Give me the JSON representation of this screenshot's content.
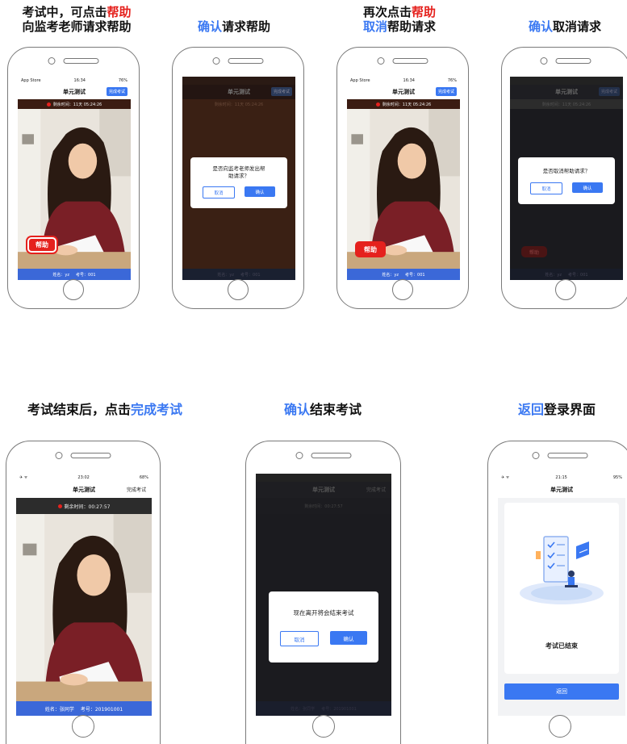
{
  "captions": {
    "c1": {
      "a": "考试中，可点击",
      "b": "帮助",
      "c": "向监考老师请求帮助"
    },
    "c2": {
      "a": "确认",
      "b": "请求帮助"
    },
    "c3": {
      "a": "再次点击",
      "b": "帮助",
      "c": "取消",
      "d": "帮助请求"
    },
    "c4": {
      "a": "确认",
      "b": "取消请求"
    },
    "c5": {
      "a": "考试结束后，点击",
      "b": "完成考试"
    },
    "c6": {
      "a": "确认",
      "b": "结束考试"
    },
    "c7": {
      "a": "返回",
      "b": "登录界面"
    }
  },
  "exam": {
    "store_label": "App Store",
    "time_1634": "16:34",
    "battery_76": "76%",
    "title": "单元测试",
    "finish_btn": "完成考试",
    "remaining_1": "剩余时间：11天 05:24:26",
    "name_1": "姓名：yz",
    "id_1": "考号：001",
    "help_label": "帮助",
    "time_2302": "23:02",
    "battery_68": "68%",
    "remaining_2": "剩余时间：00:27:57",
    "name_2": "姓名：张同学",
    "id_2": "考号：201901001",
    "time_2115": "21:15",
    "battery_95": "95%"
  },
  "dialogs": {
    "help_request": "是否向监考老师发出帮助请求？",
    "cancel_request": "是否取消帮助请求？",
    "end_exam": "现在离开将会结束考试",
    "cancel": "取消",
    "confirm": "确认"
  },
  "ended": {
    "message": "考试已结束",
    "back": "返回"
  },
  "colors": {
    "accent": "#3a78f2",
    "help": "#e5211d",
    "footer": "#3b68d8"
  }
}
